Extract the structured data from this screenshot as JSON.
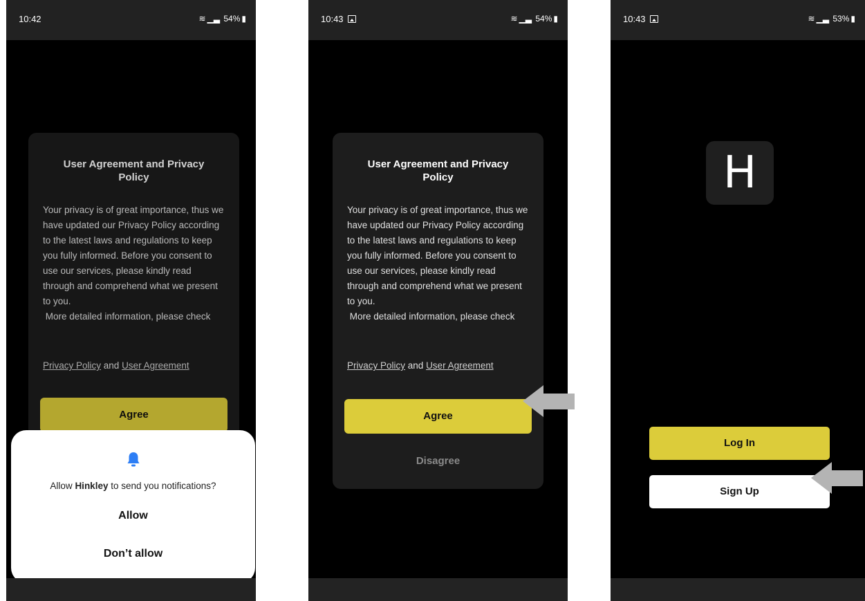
{
  "screens": [
    {
      "status": {
        "time": "10:42",
        "battery": "54%"
      },
      "dialog": {
        "title": "User Agreement and Privacy Policy",
        "body": "Your privacy is of great importance, thus we have updated our Privacy Policy according to the latest laws and regulations to keep you fully informed. Before you consent to use our services, please kindly read through and comprehend what we present to you.\n More detailed information, please check",
        "link1": "Privacy Policy",
        "and": " and ",
        "link2": "User Agreement",
        "agree": "Agree"
      },
      "permission": {
        "prefix": "Allow ",
        "app": "Hinkley",
        "suffix": " to send you notifications?",
        "allow": "Allow",
        "deny": "Don’t allow"
      }
    },
    {
      "status": {
        "time": "10:43",
        "battery": "54%"
      },
      "dialog": {
        "title": "User Agreement and Privacy Policy",
        "body": "Your privacy is of great importance, thus we have updated our Privacy Policy according to the latest laws and regulations to keep you fully informed. Before you consent to use our services, please kindly read through and comprehend what we present to you.\n More detailed information, please check",
        "link1": "Privacy Policy",
        "and": " and ",
        "link2": "User Agreement",
        "agree": "Agree",
        "disagree": "Disagree"
      }
    },
    {
      "status": {
        "time": "10:43",
        "battery": "53%"
      },
      "logo": "H",
      "login": "Log In",
      "signup": "Sign Up"
    }
  ],
  "colors": {
    "accent": "#dccc3a",
    "dialog_bg": "#1d1d1d",
    "bell": "#2d7ef5",
    "arrow": "#b4b4b4"
  }
}
